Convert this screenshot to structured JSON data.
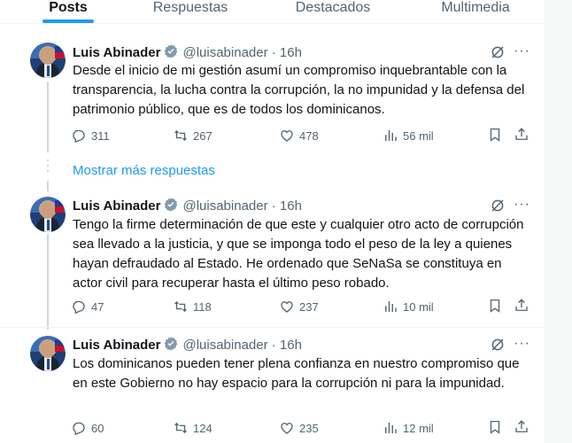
{
  "tabs": [
    {
      "label": "Posts",
      "active": true
    },
    {
      "label": "Respuestas",
      "active": false
    },
    {
      "label": "Destacados",
      "active": false
    },
    {
      "label": "Multimedia",
      "active": false
    }
  ],
  "show_more_replies": "Mostrar más respuestas",
  "tweets": [
    {
      "name": "Luis Abinader",
      "handle": "@luisabinader · 16h",
      "text": "Desde el inicio de mi gestión asumí un compromiso inquebrantable con la transparencia, la lucha contra la corrupción, la no impunidad y la defensa del patrimonio público, que es de todos los dominicanos.",
      "replies": "311",
      "reposts": "267",
      "likes": "478",
      "views": "56 mil"
    },
    {
      "name": "Luis Abinader",
      "handle": "@luisabinader · 16h",
      "text": "Tengo la firme determinación de que este y cualquier otro acto de corrupción sea llevado a la justicia, y que se imponga todo el peso de la ley a quienes hayan defraudado al Estado. He ordenado que SeNaSa se constituya en actor civil para recuperar hasta el último peso robado.",
      "replies": "47",
      "reposts": "118",
      "likes": "237",
      "views": "10 mil"
    },
    {
      "name": "Luis Abinader",
      "handle": "@luisabinader · 16h",
      "text": "Los dominicanos pueden tener plena confianza en nuestro compromiso que en este Gobierno no hay espacio para la corrupción ni para la impunidad.",
      "replies": "60",
      "reposts": "124",
      "likes": "235",
      "views": "12 mil"
    }
  ],
  "colors": {
    "accent": "#1d9bf0",
    "text": "#0f1419",
    "secondary": "#536471",
    "border": "#eff3f4"
  }
}
